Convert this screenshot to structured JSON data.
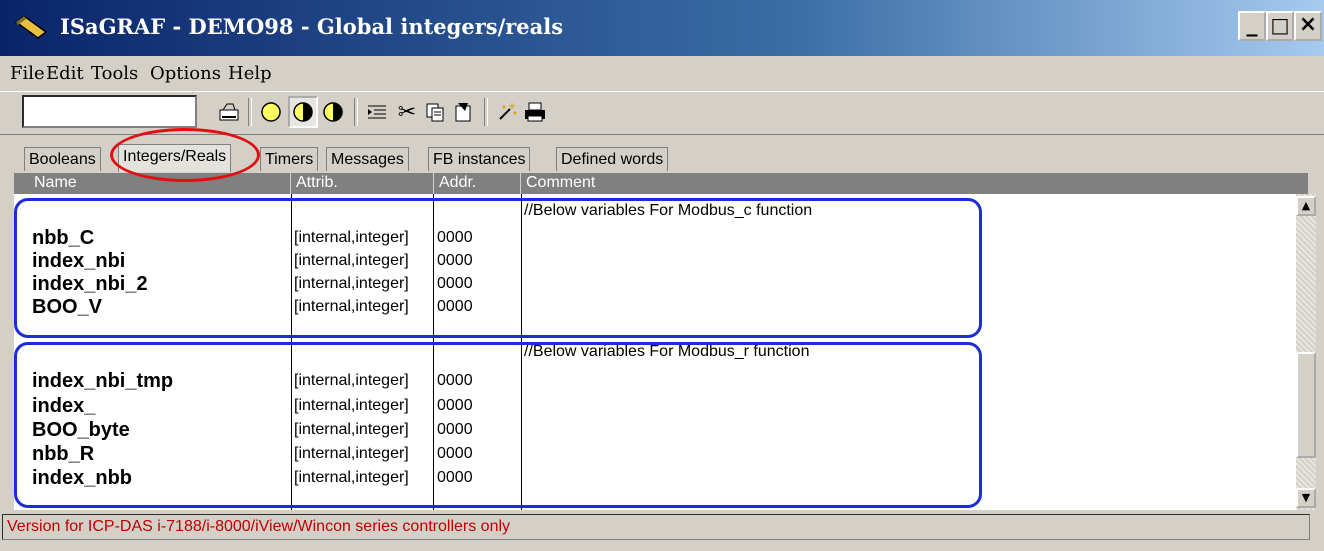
{
  "window": {
    "title": "ISaGRAF - DEMO98 - Global integers/reals",
    "buttons": [
      "_",
      "□",
      "×"
    ]
  },
  "menu": [
    "File",
    "Edit",
    "Tools",
    "Options",
    "Help"
  ],
  "toolbar": {
    "input_value": "",
    "icons": [
      "open-icon",
      "circle-empty-icon",
      "circle-half-icon",
      "circle-pie-icon",
      "indent-icon",
      "cut-icon",
      "copy-icon",
      "paste-icon",
      "wand-icon",
      "print-icon"
    ]
  },
  "tabs": [
    "Booleans",
    "Integers/Reals",
    "Timers",
    "Messages",
    "FB instances",
    "Defined words"
  ],
  "active_tab": "Integers/Reals",
  "columns": [
    "Name",
    "Attrib.",
    "Addr.",
    "Comment"
  ],
  "groups": [
    {
      "comment": "//Below variables For Modbus_c function",
      "rows": [
        {
          "name": "nbb_C",
          "attrib": "[internal,integer]",
          "addr": "0000"
        },
        {
          "name": "index_nbi",
          "attrib": "[internal,integer]",
          "addr": "0000"
        },
        {
          "name": "index_nbi_2",
          "attrib": "[internal,integer]",
          "addr": "0000"
        },
        {
          "name": "BOO_V",
          "attrib": "[internal,integer]",
          "addr": "0000"
        }
      ]
    },
    {
      "comment": "//Below variables For Modbus_r function",
      "rows": [
        {
          "name": "index_nbi_tmp",
          "attrib": "[internal,integer]",
          "addr": "0000"
        },
        {
          "name": "index_",
          "attrib": "[internal,integer]",
          "addr": "0000"
        },
        {
          "name": "BOO_byte",
          "attrib": "[internal,integer]",
          "addr": "0000"
        },
        {
          "name": "nbb_R",
          "attrib": "[internal,integer]",
          "addr": "0000"
        },
        {
          "name": "index_nbb",
          "attrib": "[internal,integer]",
          "addr": "0000"
        }
      ]
    }
  ],
  "status": "Version for ICP-DAS i-7188/i-8000/iView/Wincon series controllers only",
  "colors": {
    "title_bar": "#0a246a",
    "status_text": "#c00000",
    "group_outline": "#1c2dd6",
    "tab_highlight": "#e01010"
  }
}
